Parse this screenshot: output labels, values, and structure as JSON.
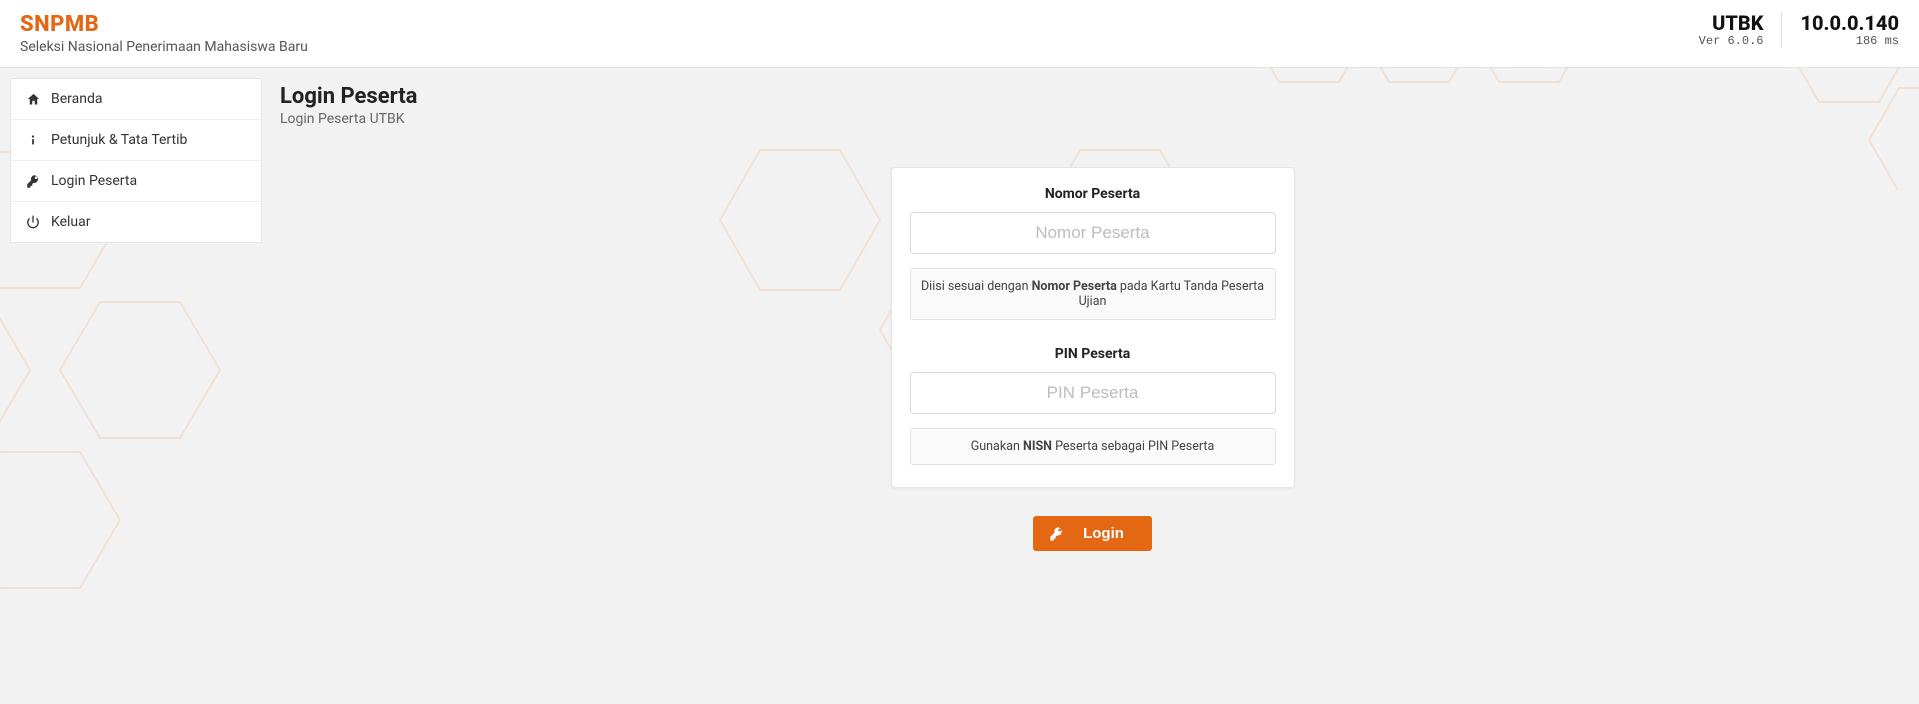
{
  "header": {
    "brand_title": "SNPMB",
    "brand_sub": "Seleksi Nasional Penerimaan Mahasiswa Baru",
    "app_name": "UTBK",
    "version_label": "Ver 6.0.6",
    "ip": "10.0.0.140",
    "latency": "186 ms"
  },
  "sidebar": {
    "items": [
      {
        "icon": "home-icon",
        "label": "Beranda"
      },
      {
        "icon": "info-icon",
        "label": "Petunjuk & Tata Tertib"
      },
      {
        "icon": "key-icon",
        "label": "Login Peserta"
      },
      {
        "icon": "power-icon",
        "label": "Keluar"
      }
    ]
  },
  "page": {
    "title": "Login Peserta",
    "subtitle": "Login Peserta UTBK"
  },
  "form": {
    "nomor": {
      "label": "Nomor Peserta",
      "placeholder": "Nomor Peserta",
      "hint_pre": "Diisi sesuai dengan ",
      "hint_bold": "Nomor Peserta",
      "hint_post": " pada Kartu Tanda Peserta Ujian"
    },
    "pin": {
      "label": "PIN Peserta",
      "placeholder": "PIN Peserta",
      "hint_pre": "Gunakan ",
      "hint_bold": "NISN",
      "hint_post": " Peserta sebagai PIN Peserta"
    },
    "login_label": "Login"
  },
  "colors": {
    "accent": "#e46713",
    "success": "#2fa84f"
  }
}
